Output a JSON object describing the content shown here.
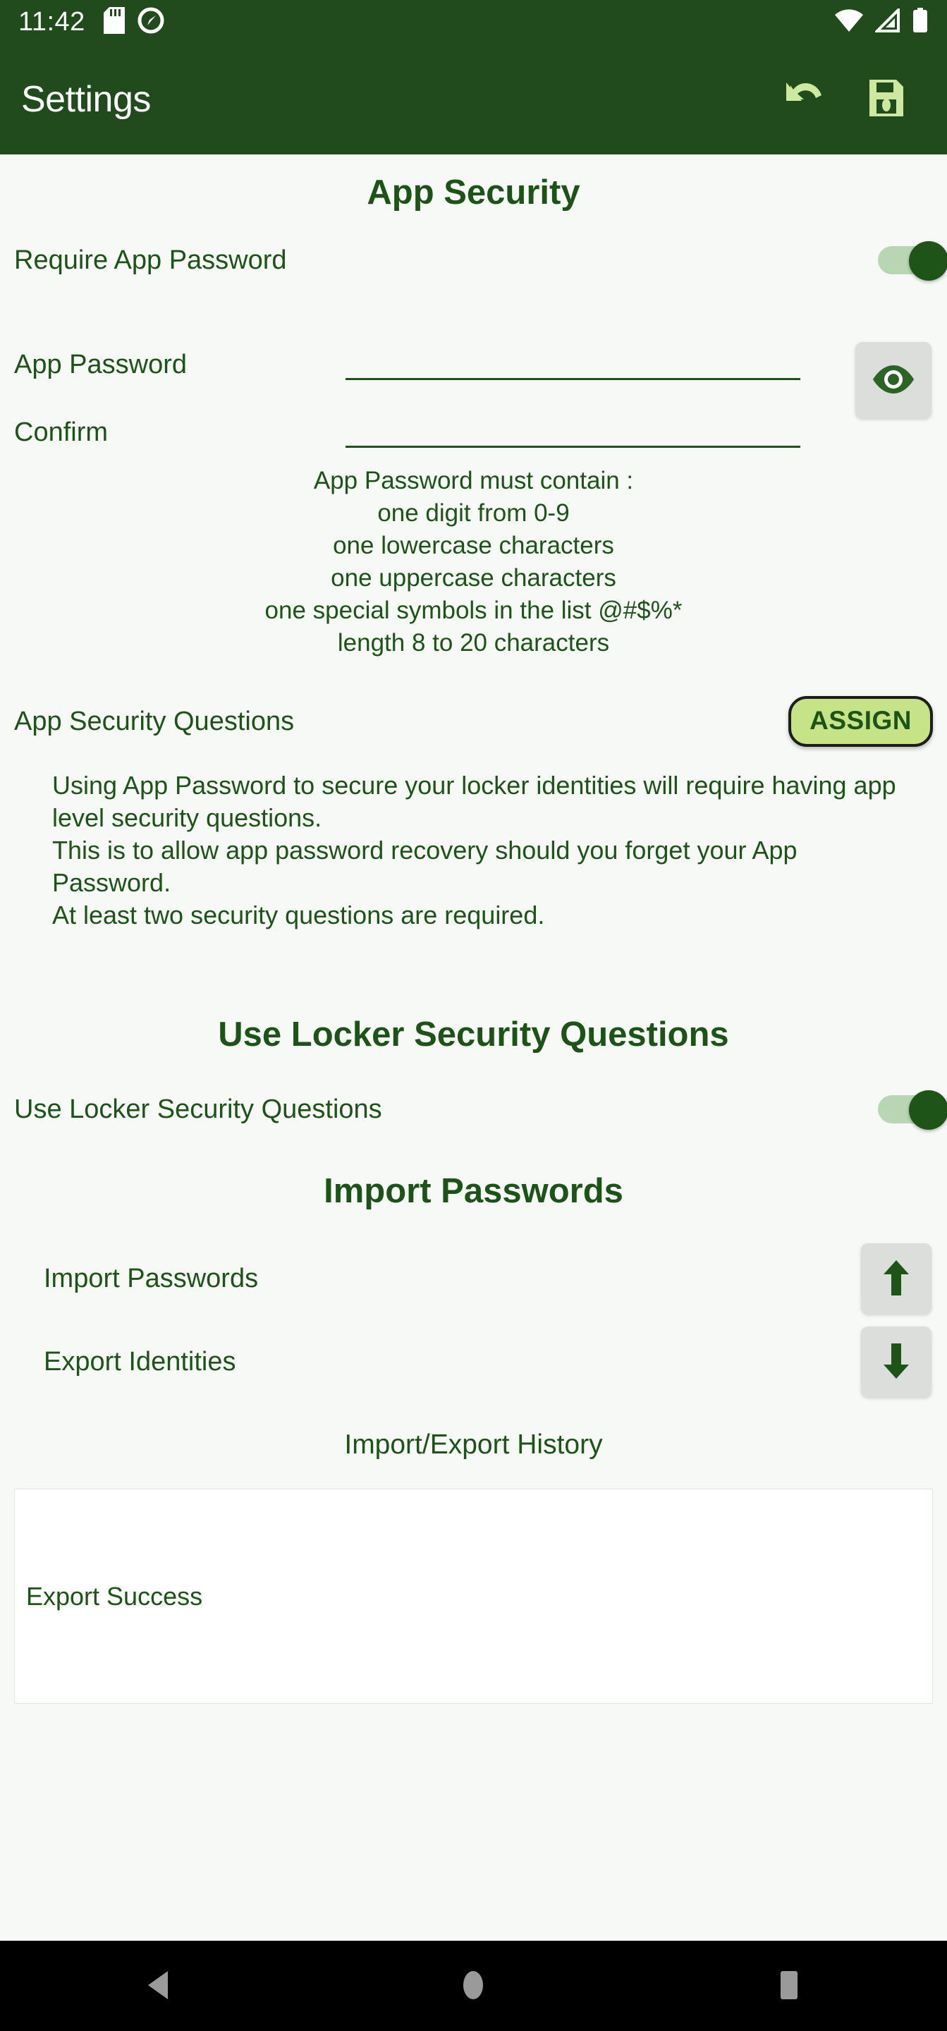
{
  "status_bar": {
    "time": "11:42",
    "left_icons": [
      "sd-card-icon",
      "location-disabled-icon"
    ],
    "right_icons": [
      "wifi-icon",
      "cell-signal-icon",
      "battery-icon"
    ]
  },
  "app_bar": {
    "title": "Settings",
    "undo_label": "undo-icon",
    "save_label": "save-icon",
    "background": "#214b1d",
    "title_color": "#ffffff",
    "icon_color": "#cfe8a0"
  },
  "theme": {
    "primary_dark_green": "#1c5417",
    "accent_light_green": "#c7e388",
    "page_background": "#f7f9f7",
    "button_grey": "#dcdedc"
  },
  "app_security": {
    "heading": "App Security",
    "require_password": {
      "label": "Require App Password",
      "state": "on"
    },
    "password_field": {
      "label": "App Password",
      "value": "",
      "placeholder": ""
    },
    "confirm_field": {
      "label": "Confirm",
      "value": "",
      "placeholder": ""
    },
    "visibility_toggle": "eye-icon",
    "hint_lines": [
      "App Password must contain :",
      "one digit from 0-9",
      "one lowercase characters",
      "one uppercase characters",
      "one special symbols in the list @#$%*",
      "length 8 to 20 characters"
    ],
    "security_questions": {
      "label": "App Security Questions",
      "button_label": "ASSIGN"
    },
    "description_lines": [
      "Using App Password to secure your locker identities will require having app level security questions.",
      "This is to allow app password recovery should you forget your App Password.",
      "At least two security questions are required."
    ]
  },
  "locker_security": {
    "heading": "Use Locker Security Questions",
    "toggle": {
      "label": "Use Locker Security Questions",
      "state": "on"
    }
  },
  "import_export": {
    "heading": "Import Passwords",
    "import_row": {
      "label": "Import Passwords",
      "icon": "arrow-up-icon"
    },
    "export_row": {
      "label": "Export Identities",
      "icon": "arrow-down-icon"
    },
    "history_title": "Import/Export History",
    "history_entries": [
      "Export Success"
    ]
  },
  "nav_bar": {
    "back": "back-triangle-icon",
    "home": "home-circle-icon",
    "recents": "recents-square-icon"
  }
}
